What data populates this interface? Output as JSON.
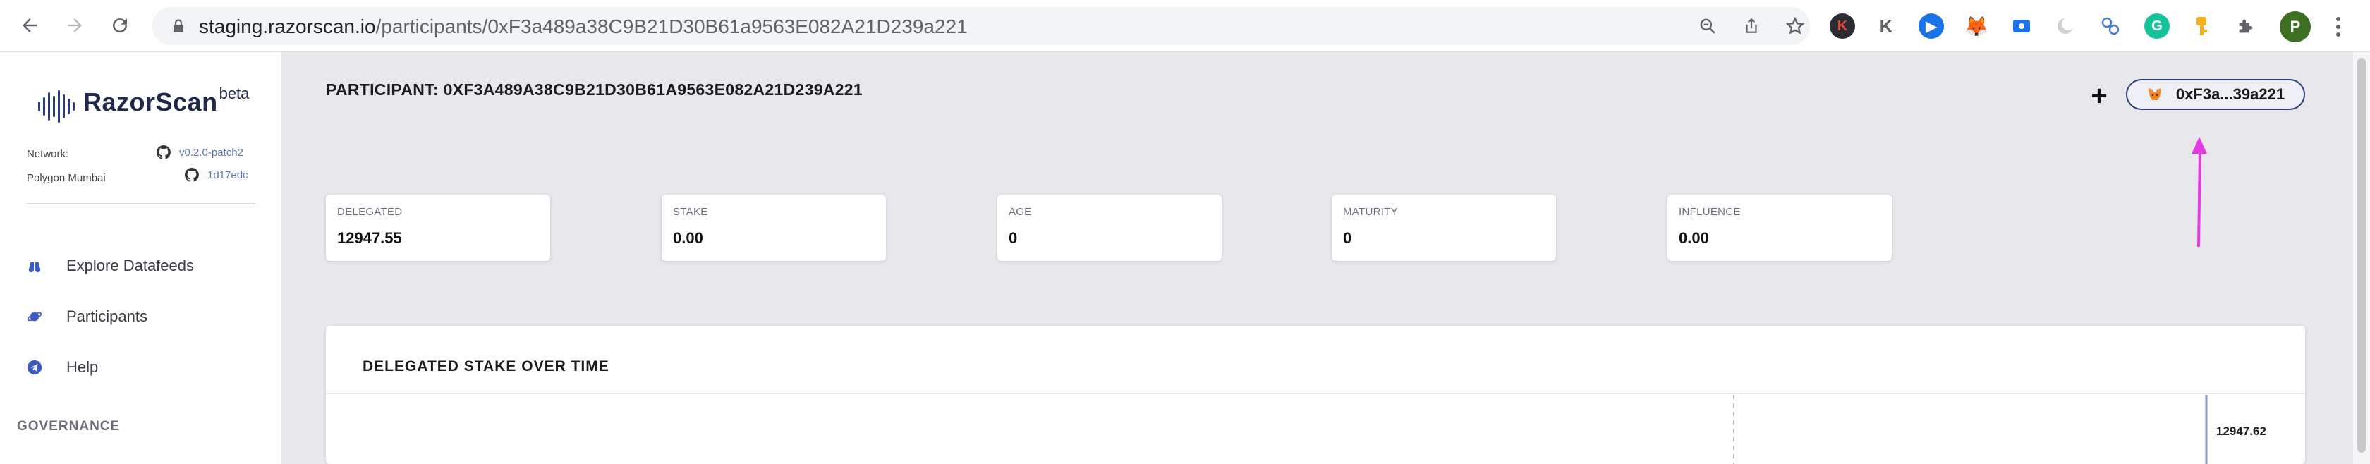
{
  "browser": {
    "url_host": "staging.razorscan.io",
    "url_path": "/participants/0xF3a489a38C9B21D30B61a9563E082A21D239a221",
    "profile_initial": "P"
  },
  "sidebar": {
    "logo_text": "RazorScan",
    "logo_beta": "beta",
    "network_label": "Network:",
    "network_name": "Polygon Mumbai",
    "version": "v0.2.0-patch2",
    "commit": "1d17edc",
    "nav": [
      {
        "label": "Explore Datafeeds",
        "icon": "binoculars-icon"
      },
      {
        "label": "Participants",
        "icon": "participants-icon"
      },
      {
        "label": "Help",
        "icon": "telegram-icon"
      }
    ],
    "section_governance": "GOVERNANCE"
  },
  "main": {
    "title": "PARTICIPANT: 0XF3A489A38C9B21D30B61A9563E082A21D239A221",
    "wallet_label": "0xF3a...39a221",
    "stats": [
      {
        "label": "DELEGATED",
        "value": "12947.55"
      },
      {
        "label": "STAKE",
        "value": "0.00"
      },
      {
        "label": "AGE",
        "value": "0"
      },
      {
        "label": "MATURITY",
        "value": "0"
      },
      {
        "label": "INFLUENCE",
        "value": "0.00"
      }
    ],
    "chart_title": "DELEGATED STAKE OVER TIME",
    "chart_tick": "12947.62"
  },
  "colors": {
    "brand": "#2c3e7a",
    "annotation_arrow": "#e23be0",
    "background": "#e8e8ec"
  }
}
